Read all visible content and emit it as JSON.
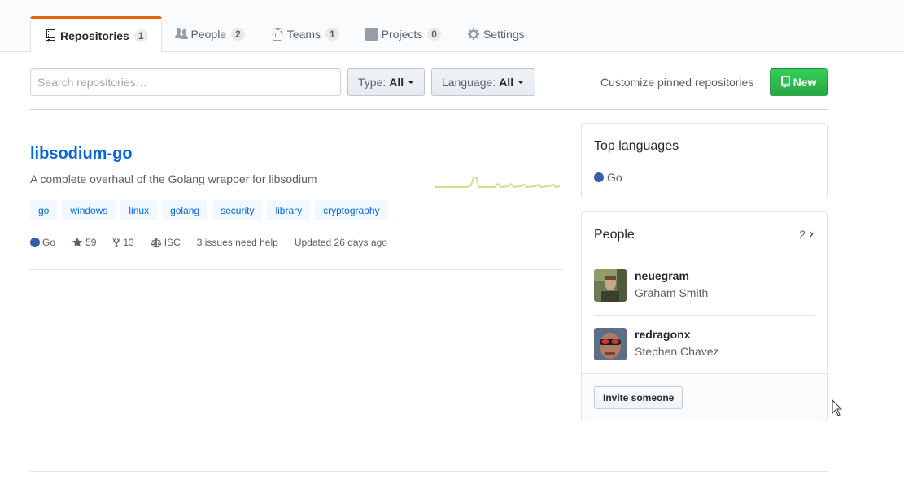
{
  "tabs": [
    {
      "label": "Repositories",
      "count": "1"
    },
    {
      "label": "People",
      "count": "2"
    },
    {
      "label": "Teams",
      "count": "1"
    },
    {
      "label": "Projects",
      "count": "0"
    },
    {
      "label": "Settings"
    }
  ],
  "filters": {
    "search_placeholder": "Search repositories…",
    "search_value": "",
    "type_label": "Type:",
    "type_value": "All",
    "language_label": "Language:",
    "language_value": "All",
    "customize_label": "Customize pinned repositories",
    "new_label": "New"
  },
  "repo": {
    "name": "libsodium-go",
    "description": "A complete overhaul of the Golang wrapper for libsodium",
    "topics": [
      "go",
      "windows",
      "linux",
      "golang",
      "security",
      "library",
      "cryptography"
    ],
    "language": "Go",
    "language_color": "#375eab",
    "stars": "59",
    "forks": "13",
    "license": "ISC",
    "issues": "3 issues need help",
    "updated": "Updated 26 days ago"
  },
  "sidebar": {
    "top_languages_title": "Top languages",
    "languages": [
      {
        "name": "Go",
        "color": "#375eab"
      }
    ],
    "people_title": "People",
    "people_count": "2",
    "people": [
      {
        "login": "neuegram",
        "name": "Graham Smith"
      },
      {
        "login": "redragonx",
        "name": "Stephen Chavez"
      }
    ],
    "invite_label": "Invite someone"
  },
  "colors": {
    "accent_tab": "#e36209",
    "link": "#0366d6",
    "new_button": "#28a745",
    "sparkline": "#c6e48b"
  }
}
